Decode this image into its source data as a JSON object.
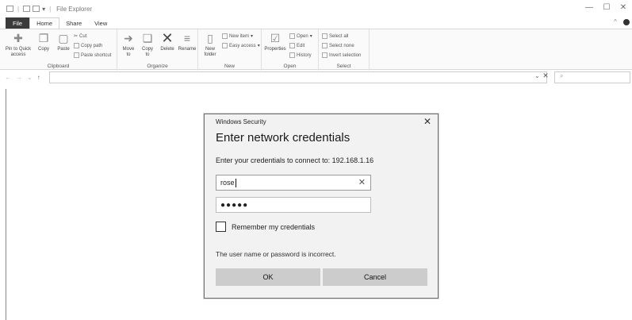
{
  "window": {
    "title": "File Explorer"
  },
  "window_controls": {
    "minimize": "—",
    "maximize": "☐",
    "close": "✕"
  },
  "tabs": [
    {
      "label": "File"
    },
    {
      "label": "Home"
    },
    {
      "label": "Share"
    },
    {
      "label": "View"
    }
  ],
  "ribbon": {
    "clipboard": {
      "label": "Clipboard",
      "pin_label": "Pin to Quick access",
      "copy_label": "Copy",
      "paste_label": "Paste",
      "cut_label": "Cut",
      "copy_path_label": "Copy path",
      "paste_shortcut_label": "Paste shortcut"
    },
    "organize": {
      "label": "Organize",
      "move_to_label": "Move to",
      "copy_to_label": "Copy to",
      "delete_label": "Delete",
      "rename_label": "Rename"
    },
    "new": {
      "label": "New",
      "new_folder_label": "New folder",
      "new_item_label": "New item",
      "easy_access_label": "Easy access"
    },
    "open": {
      "label": "Open",
      "properties_label": "Properties",
      "open_label": "Open",
      "edit_label": "Edit",
      "history_label": "History"
    },
    "select": {
      "label": "Select",
      "select_all_label": "Select all",
      "select_none_label": "Select none",
      "invert_label": "Invert selection"
    }
  },
  "address_bar": {
    "value": ""
  },
  "dialog": {
    "title": "Windows Security",
    "heading": "Enter network credentials",
    "subtitle": "Enter your credentials to connect to: 192.168.1.16",
    "username": "rose",
    "password_mask": "●●●●●",
    "remember_label": "Remember my credentials",
    "remember_checked": false,
    "error": "The user name or password is incorrect.",
    "ok_label": "OK",
    "cancel_label": "Cancel"
  }
}
